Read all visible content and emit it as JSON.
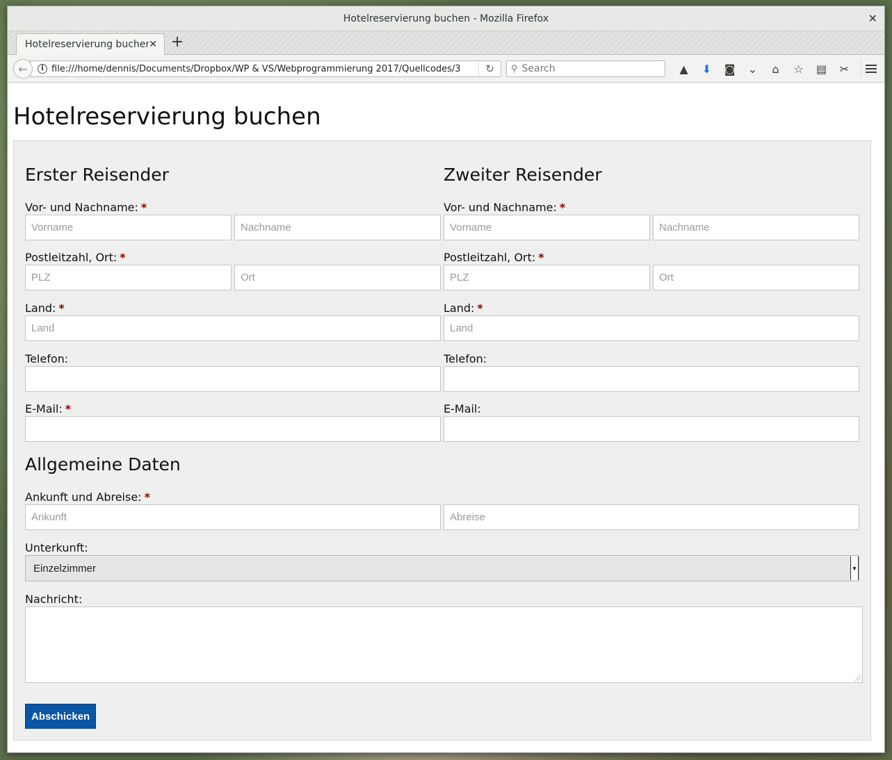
{
  "window": {
    "title": "Hotelreservierung buchen - Mozilla Firefox",
    "close_glyph": "✕"
  },
  "tab": {
    "label": "Hotelreservierung buchen",
    "close_glyph": "✕",
    "new_tab_glyph": "+"
  },
  "navbar": {
    "back_glyph": "←",
    "info_glyph": "i",
    "url": "file:///home/dennis/Documents/Dropbox/WP & VS/Webprogrammierung 2017/Quellcodes/3",
    "reload_glyph": "↻",
    "search_placeholder": "Search",
    "search_glyph": "⚲",
    "toolbar_icons": [
      "hat-icon",
      "download-icon",
      "screenshot-icon",
      "pocket-icon",
      "home-icon",
      "bookmark-star-icon",
      "reader-list-icon",
      "extension-icon"
    ],
    "toolbar_glyphs": {
      "hat": "▲",
      "download": "⬇",
      "screenshot": "◙",
      "pocket": "⌄",
      "home": "⌂",
      "star": "☆",
      "list": "▤",
      "extension": "✂"
    }
  },
  "page": {
    "title": "Hotelreservierung buchen"
  },
  "form": {
    "required_marker": "*",
    "traveler1": {
      "heading": "Erster Reisender",
      "name_label": "Vor- und Nachname:",
      "firstname_placeholder": "Vorname",
      "lastname_placeholder": "Nachname",
      "zip_label": "Postleitzahl, Ort:",
      "zip_placeholder": "PLZ",
      "city_placeholder": "Ort",
      "country_label": "Land:",
      "country_placeholder": "Land",
      "phone_label": "Telefon:",
      "email_label": "E-Mail:"
    },
    "traveler2": {
      "heading": "Zweiter Reisender",
      "name_label": "Vor- und Nachname:",
      "firstname_placeholder": "Vorname",
      "lastname_placeholder": "Nachname",
      "zip_label": "Postleitzahl, Ort:",
      "zip_placeholder": "PLZ",
      "city_placeholder": "Ort",
      "country_label": "Land:",
      "country_placeholder": "Land",
      "phone_label": "Telefon:",
      "email_label": "E-Mail:"
    },
    "general": {
      "heading": "Allgemeine Daten",
      "dates_label": "Ankunft und Abreise:",
      "arrival_placeholder": "Ankunft",
      "departure_placeholder": "Abreise",
      "accommodation_label": "Unterkunft:",
      "accommodation_value": "Einzelzimmer",
      "accommodation_arrow": "▼",
      "message_label": "Nachricht:"
    },
    "submit_label": "Abschicken"
  },
  "colors": {
    "accent": "#0b55a5",
    "required": "#8b0000",
    "form_background": "#efefef"
  }
}
